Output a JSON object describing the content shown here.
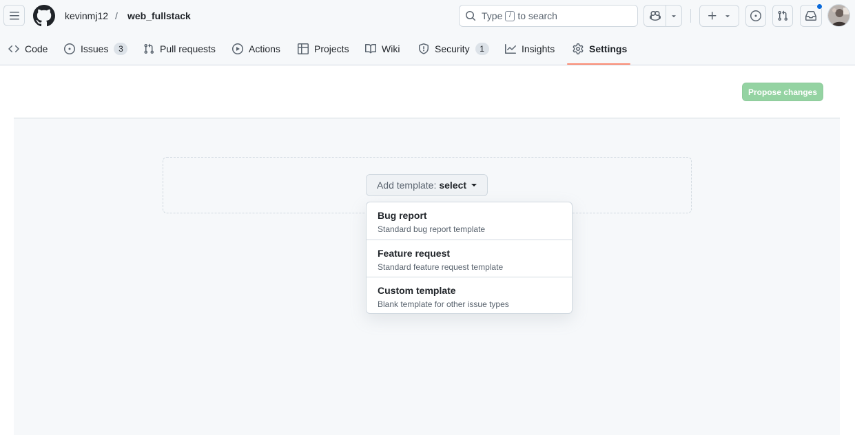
{
  "header": {
    "owner": "kevinmj12",
    "separator": "/",
    "repo": "web_fullstack",
    "search": {
      "prefix": "Type",
      "key": "/",
      "suffix": "to search"
    }
  },
  "repo_nav": {
    "tabs": [
      {
        "label": "Code",
        "icon": "code-icon"
      },
      {
        "label": "Issues",
        "icon": "issue-opened-icon",
        "counter": "3"
      },
      {
        "label": "Pull requests",
        "icon": "git-pull-request-icon"
      },
      {
        "label": "Actions",
        "icon": "play-icon"
      },
      {
        "label": "Projects",
        "icon": "table-icon"
      },
      {
        "label": "Wiki",
        "icon": "book-icon"
      },
      {
        "label": "Security",
        "icon": "shield-icon",
        "counter": "1"
      },
      {
        "label": "Insights",
        "icon": "graph-icon"
      },
      {
        "label": "Settings",
        "icon": "gear-icon",
        "selected": true
      }
    ]
  },
  "content": {
    "propose_label": "Propose changes",
    "add_template_prefix": "Add template:",
    "add_template_value": "select",
    "menu": [
      {
        "title": "Bug report",
        "description": "Standard bug report template"
      },
      {
        "title": "Feature request",
        "description": "Standard feature request template"
      },
      {
        "title": "Custom template",
        "description": "Blank template for other issue types"
      }
    ]
  },
  "colors": {
    "accent_underline": "#fd8c73",
    "propose_disabled": "#94d3a2",
    "notification": "#0969da"
  }
}
